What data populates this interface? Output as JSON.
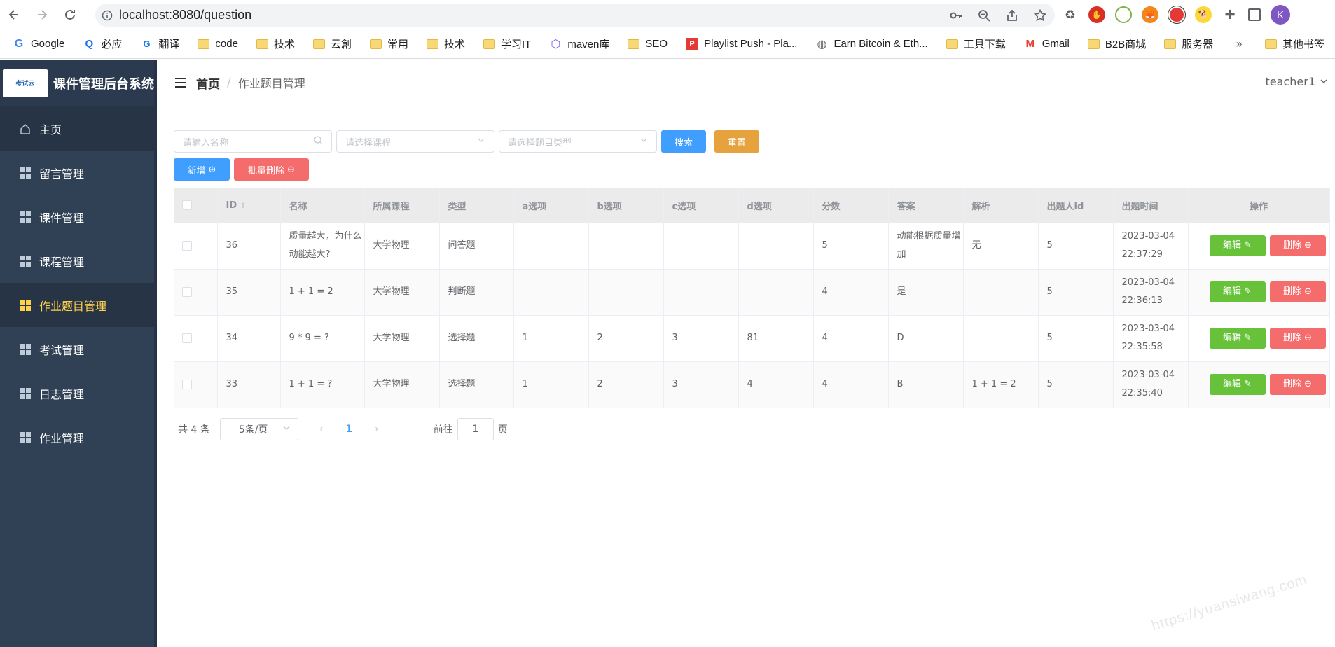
{
  "browser": {
    "url": "localhost:8080/question",
    "avatar_letter": "K",
    "bookmarks": [
      "Google",
      "必应",
      "翻译",
      "code",
      "技术",
      "云創",
      "常用",
      "技术",
      "学习IT",
      "maven库",
      "SEO",
      "Playlist Push - Pla...",
      "Earn Bitcoin & Eth...",
      "工具下载",
      "Gmail",
      "B2B商城",
      "服务器"
    ],
    "bookmarks_more": "»",
    "other_bookmarks": "其他书签"
  },
  "app": {
    "logo_text": "考试云",
    "title": "课件管理后台系统",
    "menu": [
      "主页",
      "留言管理",
      "课件管理",
      "课程管理",
      "作业题目管理",
      "考试管理",
      "日志管理",
      "作业管理"
    ],
    "active_menu": "作业题目管理",
    "breadcrumb_home": "首页",
    "breadcrumb_sep": "/",
    "breadcrumb_current": "作业题目管理",
    "user": "teacher1"
  },
  "filters": {
    "name_placeholder": "请输入名称",
    "course_placeholder": "请选择课程",
    "type_placeholder": "请选择题目类型",
    "search": "搜索",
    "reset": "重置",
    "add": "新增",
    "batch_delete": "批量删除"
  },
  "table": {
    "headers": [
      "ID",
      "名称",
      "所属课程",
      "类型",
      "a选项",
      "b选项",
      "c选项",
      "d选项",
      "分数",
      "答案",
      "解析",
      "出题人id",
      "出题时间",
      "操作"
    ],
    "rows": [
      {
        "id": "36",
        "name": "质量越大，为什么动能越大?",
        "course": "大学物理",
        "type": "问答题",
        "a": "",
        "b": "",
        "c": "",
        "d": "",
        "score": "5",
        "answer": "动能根据质量增加",
        "analysis": "无",
        "author": "5",
        "time": "2023-03-04 22:37:29"
      },
      {
        "id": "35",
        "name": "1 + 1 = 2",
        "course": "大学物理",
        "type": "判断题",
        "a": "",
        "b": "",
        "c": "",
        "d": "",
        "score": "4",
        "answer": "是",
        "analysis": "",
        "author": "5",
        "time": "2023-03-04 22:36:13"
      },
      {
        "id": "34",
        "name": "9 * 9 = ?",
        "course": "大学物理",
        "type": "选择题",
        "a": "1",
        "b": "2",
        "c": "3",
        "d": "81",
        "score": "4",
        "answer": "D",
        "analysis": "",
        "author": "5",
        "time": "2023-03-04 22:35:58"
      },
      {
        "id": "33",
        "name": "1 + 1 = ?",
        "course": "大学物理",
        "type": "选择题",
        "a": "1",
        "b": "2",
        "c": "3",
        "d": "4",
        "score": "4",
        "answer": "B",
        "analysis": "1 + 1 = 2",
        "author": "5",
        "time": "2023-03-04 22:35:40"
      }
    ],
    "edit_label": "编辑",
    "delete_label": "删除"
  },
  "pagination": {
    "total": "共 4 条",
    "page_size": "5条/页",
    "current_page": "1",
    "goto_label": "前往",
    "goto_value": "1",
    "page_word": "页"
  },
  "watermark": "https://yuansiwang.com"
}
